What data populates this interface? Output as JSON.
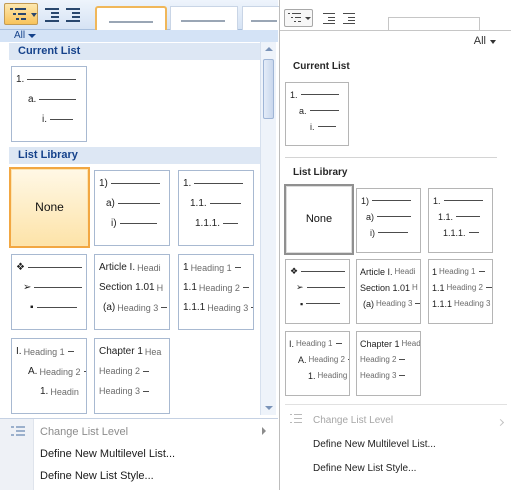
{
  "left_pane": {
    "filter": "All",
    "sections": {
      "current": "Current List",
      "library": "List Library"
    },
    "current_tile": {
      "rows": [
        {
          "label": "1."
        },
        {
          "label": "a."
        },
        {
          "label": "i."
        }
      ]
    },
    "library_tiles": [
      {
        "kind": "none",
        "label": "None"
      },
      {
        "rows": [
          {
            "label": "1)"
          },
          {
            "label": "a)"
          },
          {
            "label": "i)"
          }
        ]
      },
      {
        "rows": [
          {
            "label": "1."
          },
          {
            "label": "1.1."
          },
          {
            "label": "1.1.1."
          }
        ]
      },
      {
        "rows": [
          {
            "label": "❖"
          },
          {
            "label": "➢"
          },
          {
            "label": "▪"
          }
        ]
      },
      {
        "rows": [
          {
            "label": "Article I.",
            "heading": "Headi"
          },
          {
            "label": "Section 1.01",
            "heading": "H"
          },
          {
            "label": "(a)",
            "heading": "Heading 3"
          }
        ]
      },
      {
        "rows": [
          {
            "label": "1",
            "heading": "Heading 1"
          },
          {
            "label": "1.1",
            "heading": "Heading 2"
          },
          {
            "label": "1.1.1",
            "heading": "Heading 3"
          }
        ]
      },
      {
        "rows": [
          {
            "label": "I.",
            "heading": "Heading 1"
          },
          {
            "label": "A.",
            "heading": "Heading 2"
          },
          {
            "label": "1.",
            "heading": "Headin"
          }
        ]
      },
      {
        "rows": [
          {
            "label": "Chapter 1",
            "heading": "Hea"
          },
          {
            "label": "",
            "heading": "Heading 2"
          },
          {
            "label": "",
            "heading": "Heading 3"
          }
        ]
      }
    ],
    "menu": {
      "change_level": "Change List Level",
      "define_multilevel": "Define New Multilevel List...",
      "define_style": "Define New List Style..."
    }
  },
  "right_pane": {
    "filter": "All",
    "sections": {
      "current": "Current List",
      "library": "List Library"
    },
    "current_tile": {
      "rows": [
        {
          "label": "1."
        },
        {
          "label": "a."
        },
        {
          "label": "i."
        }
      ]
    },
    "library_tiles": [
      {
        "kind": "none",
        "label": "None"
      },
      {
        "rows": [
          {
            "label": "1)"
          },
          {
            "label": "a)"
          },
          {
            "label": "i)"
          }
        ]
      },
      {
        "rows": [
          {
            "label": "1."
          },
          {
            "label": "1.1."
          },
          {
            "label": "1.1.1."
          }
        ]
      },
      {
        "rows": [
          {
            "label": "❖"
          },
          {
            "label": "➢"
          },
          {
            "label": "▪"
          }
        ]
      },
      {
        "rows": [
          {
            "label": "Article I.",
            "heading": "Headi"
          },
          {
            "label": "Section 1.01",
            "heading": "H"
          },
          {
            "label": "(a)",
            "heading": "Heading 3"
          }
        ]
      },
      {
        "rows": [
          {
            "label": "1",
            "heading": "Heading 1"
          },
          {
            "label": "1.1",
            "heading": "Heading 2"
          },
          {
            "label": "1.1.1",
            "heading": "Heading 3"
          }
        ]
      },
      {
        "rows": [
          {
            "label": "I.",
            "heading": "Heading 1"
          },
          {
            "label": "A.",
            "heading": "Heading 2"
          },
          {
            "label": "1.",
            "heading": "Heading"
          }
        ]
      },
      {
        "rows": [
          {
            "label": "Chapter 1",
            "heading": "Head"
          },
          {
            "label": "",
            "heading": "Heading 2"
          },
          {
            "label": "",
            "heading": "Heading 3"
          }
        ]
      }
    ],
    "menu": {
      "change_level": "Change List Level",
      "define_multilevel": "Define New Multilevel List...",
      "define_style": "Define New List Style..."
    }
  },
  "colors": {
    "office2007_selected": "#f2a742",
    "office2007_header_text": "#15428b",
    "office2007_header_bg": "#dde7f4"
  }
}
